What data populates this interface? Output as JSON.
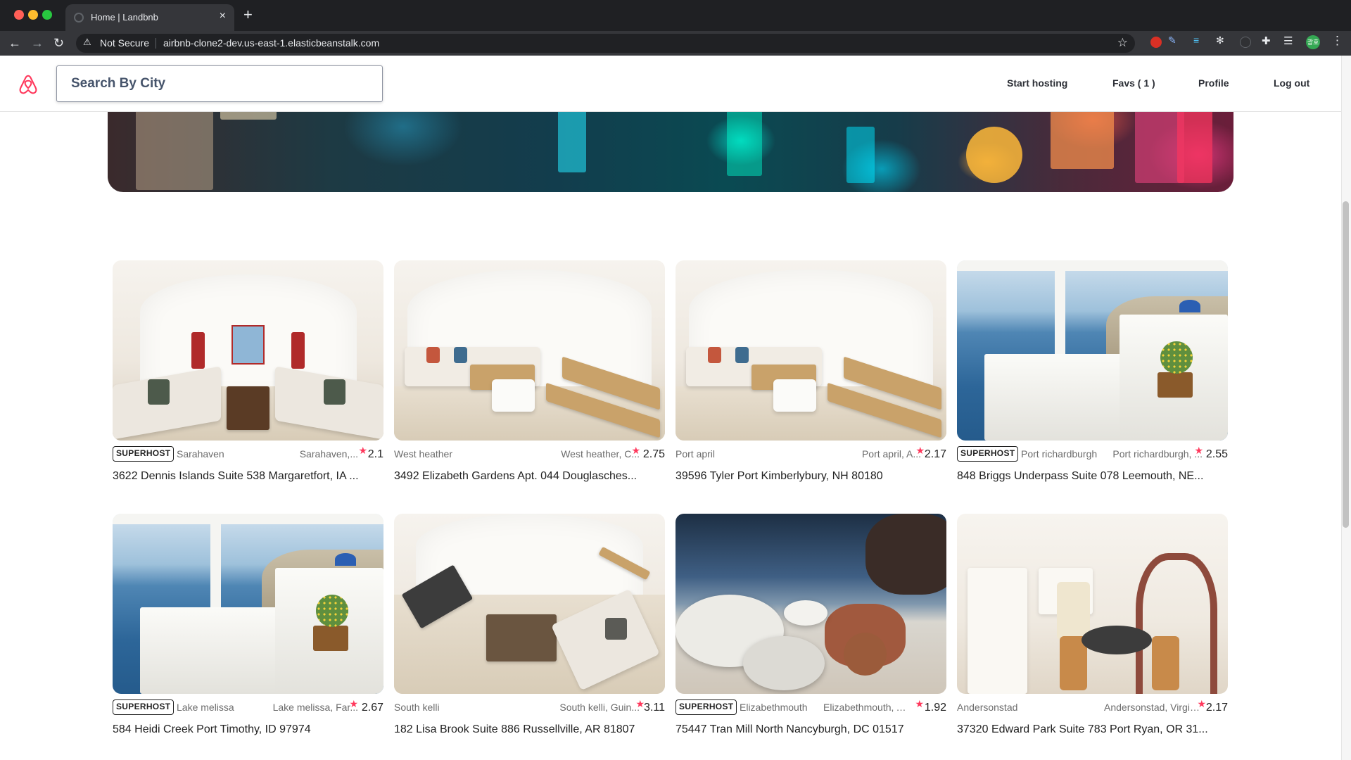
{
  "browser": {
    "tab_title": "Home | Landbnb",
    "tab_close": "×",
    "new_tab": "+",
    "security_label": "Not Secure",
    "url": "airbnb-clone2-dev.us-east-1.elasticbeanstalk.com",
    "profile_initials": "광호"
  },
  "header": {
    "search_placeholder": "Search By City",
    "nav": {
      "start_hosting": "Start hosting",
      "favs": "Favs ( 1 )",
      "profile": "Profile",
      "logout": "Log out"
    },
    "brand_color": "#ff385c"
  },
  "listings": [
    {
      "superhost": "SUPERHOST",
      "city": "Sarahaven",
      "locality": "Sarahaven,...",
      "rating": "2.1",
      "address": "3622 Dennis Islands Suite 538 Margaretfort, IA ..."
    },
    {
      "superhost": "",
      "city": "West heather",
      "locality": "West heather, C...",
      "rating": "2.75",
      "address": "3492 Elizabeth Gardens Apt. 044 Douglasches..."
    },
    {
      "superhost": "",
      "city": "Port april",
      "locality": "Port april, A...",
      "rating": "2.17",
      "address": "39596 Tyler Port Kimberlybury, NH 80180"
    },
    {
      "superhost": "SUPERHOST",
      "city": "Port richardburgh",
      "locality": "Port richardburgh, ...",
      "rating": "2.55",
      "address": "848 Briggs Underpass Suite 078 Leemouth, NE..."
    },
    {
      "superhost": "SUPERHOST",
      "city": "Lake melissa",
      "locality": "Lake melissa, Far...",
      "rating": "2.67",
      "address": "584 Heidi Creek Port Timothy, ID 97974"
    },
    {
      "superhost": "",
      "city": "South kelli",
      "locality": "South kelli, Guin...",
      "rating": "3.11",
      "address": "182 Lisa Brook Suite 886 Russellville, AR 81807"
    },
    {
      "superhost": "SUPERHOST",
      "city": "Elizabethmouth",
      "locality": "Elizabethmouth, Anti...",
      "rating": "1.92",
      "address": "75447 Tran Mill North Nancyburgh, DC 01517"
    },
    {
      "superhost": "",
      "city": "Andersonstad",
      "locality": "Andersonstad, Virgin...",
      "rating": "2.17",
      "address": "37320 Edward Park Suite 783 Port Ryan, OR 31..."
    }
  ],
  "icons": {
    "star": "★",
    "logo": "airbnb-logo-icon"
  }
}
